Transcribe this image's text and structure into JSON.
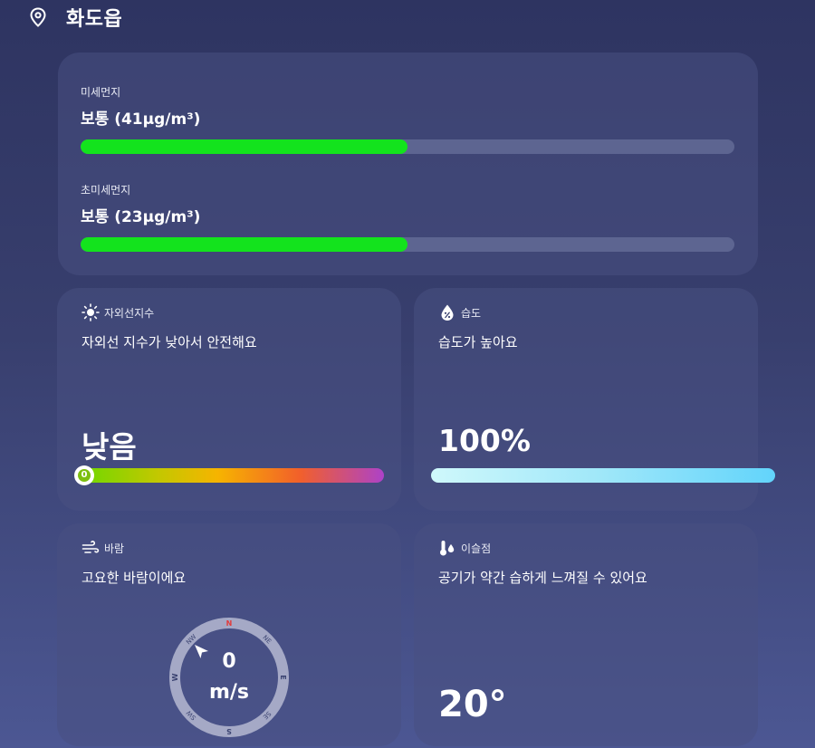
{
  "header": {
    "location": "화도읍",
    "location_icon": "map-pin-icon"
  },
  "colors": {
    "good": "#13e31d",
    "bar_track": "#5d6591",
    "compass_north": "#e23b3b"
  },
  "dust": {
    "pm10": {
      "label": "미세먼지",
      "value_text": "보통 (41µg/m³)",
      "level": 0.5
    },
    "pm25": {
      "label": "초미세먼지",
      "value_text": "보통 (23µg/m³)",
      "level": 0.5
    }
  },
  "uv": {
    "icon": "sun-icon",
    "title": "자외선지수",
    "description": "자외선 지수가 낮아서 안전해요",
    "level_text": "낮음",
    "index": "0"
  },
  "humidity": {
    "icon": "water-drop-percent-icon",
    "title": "습도",
    "description": "습도가 높아요",
    "value": "100%",
    "level": 1.0
  },
  "wind": {
    "icon": "wind-icon",
    "title": "바람",
    "description": "고요한 바람이에요",
    "speed": "0",
    "unit": "m/s",
    "compass": {
      "N": "N",
      "NE": "NE",
      "E": "E",
      "SE": "SE",
      "S": "S",
      "SW": "SW",
      "W": "W",
      "NW": "NW"
    }
  },
  "dew_point": {
    "icon": "thermometer-drop-icon",
    "title": "이슬점",
    "description": "공기가 약간 습하게 느껴질 수 있어요",
    "value": "20°"
  }
}
